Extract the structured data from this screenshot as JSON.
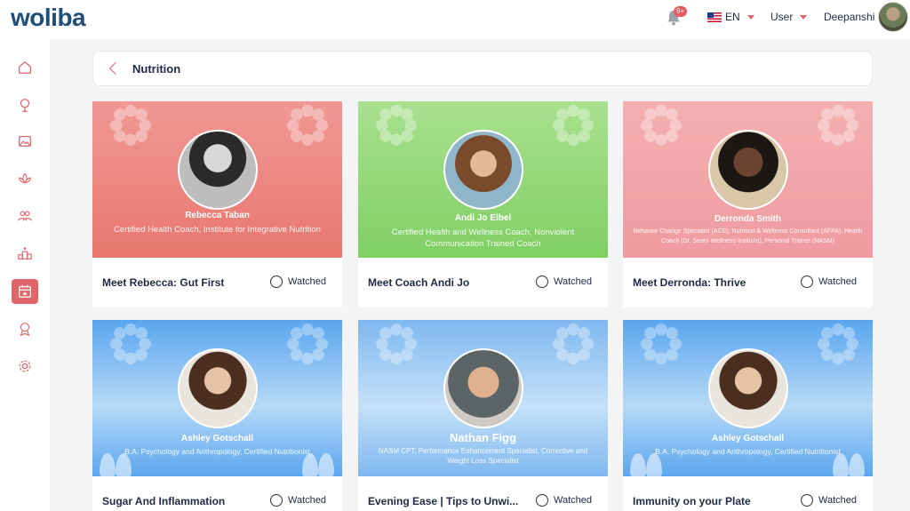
{
  "app": {
    "logo_text": "woliba"
  },
  "header": {
    "notification_badge": "9+",
    "language": "EN",
    "user_menu": "User",
    "username": "Deepanshi"
  },
  "sidebar": {
    "items": [
      {
        "icon": "home-icon"
      },
      {
        "icon": "tree-icon"
      },
      {
        "icon": "image-icon"
      },
      {
        "icon": "lotus-icon"
      },
      {
        "icon": "people-icon"
      },
      {
        "icon": "podium-icon"
      },
      {
        "icon": "calendar-star-icon",
        "active": true
      },
      {
        "icon": "award-icon"
      },
      {
        "icon": "gear-icon"
      }
    ]
  },
  "breadcrumb": {
    "title": "Nutrition"
  },
  "cards": [
    {
      "title": "Meet Rebecca: Gut First",
      "watched_label": "Watched",
      "person": "Rebecca Taban",
      "description": "Certified Health Coach, Institute for Integrative Nutrition",
      "theme": "#e8776f"
    },
    {
      "title": "Meet Coach Andi Jo",
      "watched_label": "Watched",
      "person": "Andi Jo Elbel",
      "description": "Certified Health and Wellness Coach, Nonviolent Communication Trained Coach",
      "theme": "#7fd063"
    },
    {
      "title": "Meet Derronda: Thrive",
      "watched_label": "Watched",
      "person": "Derronda Smith",
      "description": "Behavior Change Specialist (ACE), Nutrition & Wellness Consultant (AFPA), Health Coach (Dr. Sears Wellness Institute), Personal Trainer (NASM)",
      "theme": "#ef9ba0"
    },
    {
      "title": "Sugar And Inflammation",
      "watched_label": "Watched",
      "person": "Ashley Gotschall",
      "description": "B.A. Psychology and Anthropology, Certified Nutritionist",
      "theme": "#5aa6ef"
    },
    {
      "title": "Evening Ease | Tips to Unwi...",
      "watched_label": "Watched",
      "person": "Nathan Figg",
      "description": "NASM CPT, Performance Enhancement Specialist, Corrective and Weight Loss Specialist",
      "theme": "#7fb8f0"
    },
    {
      "title": "Immunity on your Plate",
      "watched_label": "Watched",
      "person": "Ashley Gotschall",
      "description": "B.A. Psychology and Anthropology, Certified Nutritionist",
      "theme": "#5aa6ef"
    }
  ],
  "colors": {
    "accent": "#e0666b",
    "brand": "#1f4e79"
  }
}
